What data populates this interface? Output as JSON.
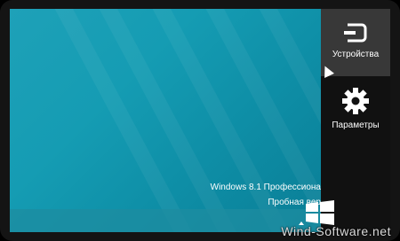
{
  "charms": {
    "devices_label": "Устройства",
    "settings_label": "Параметры",
    "devices_icon": "devices-icon",
    "settings_icon": "gear-icon"
  },
  "desktop": {
    "os_watermark": "Windows 8.1 Профессиона",
    "edition_watermark": "Пробная вер"
  },
  "site_watermark": "Wind-Software.net",
  "colors": {
    "desktop": "#159cb3",
    "charms_bar": "#111111",
    "charm_active": "#383838"
  }
}
